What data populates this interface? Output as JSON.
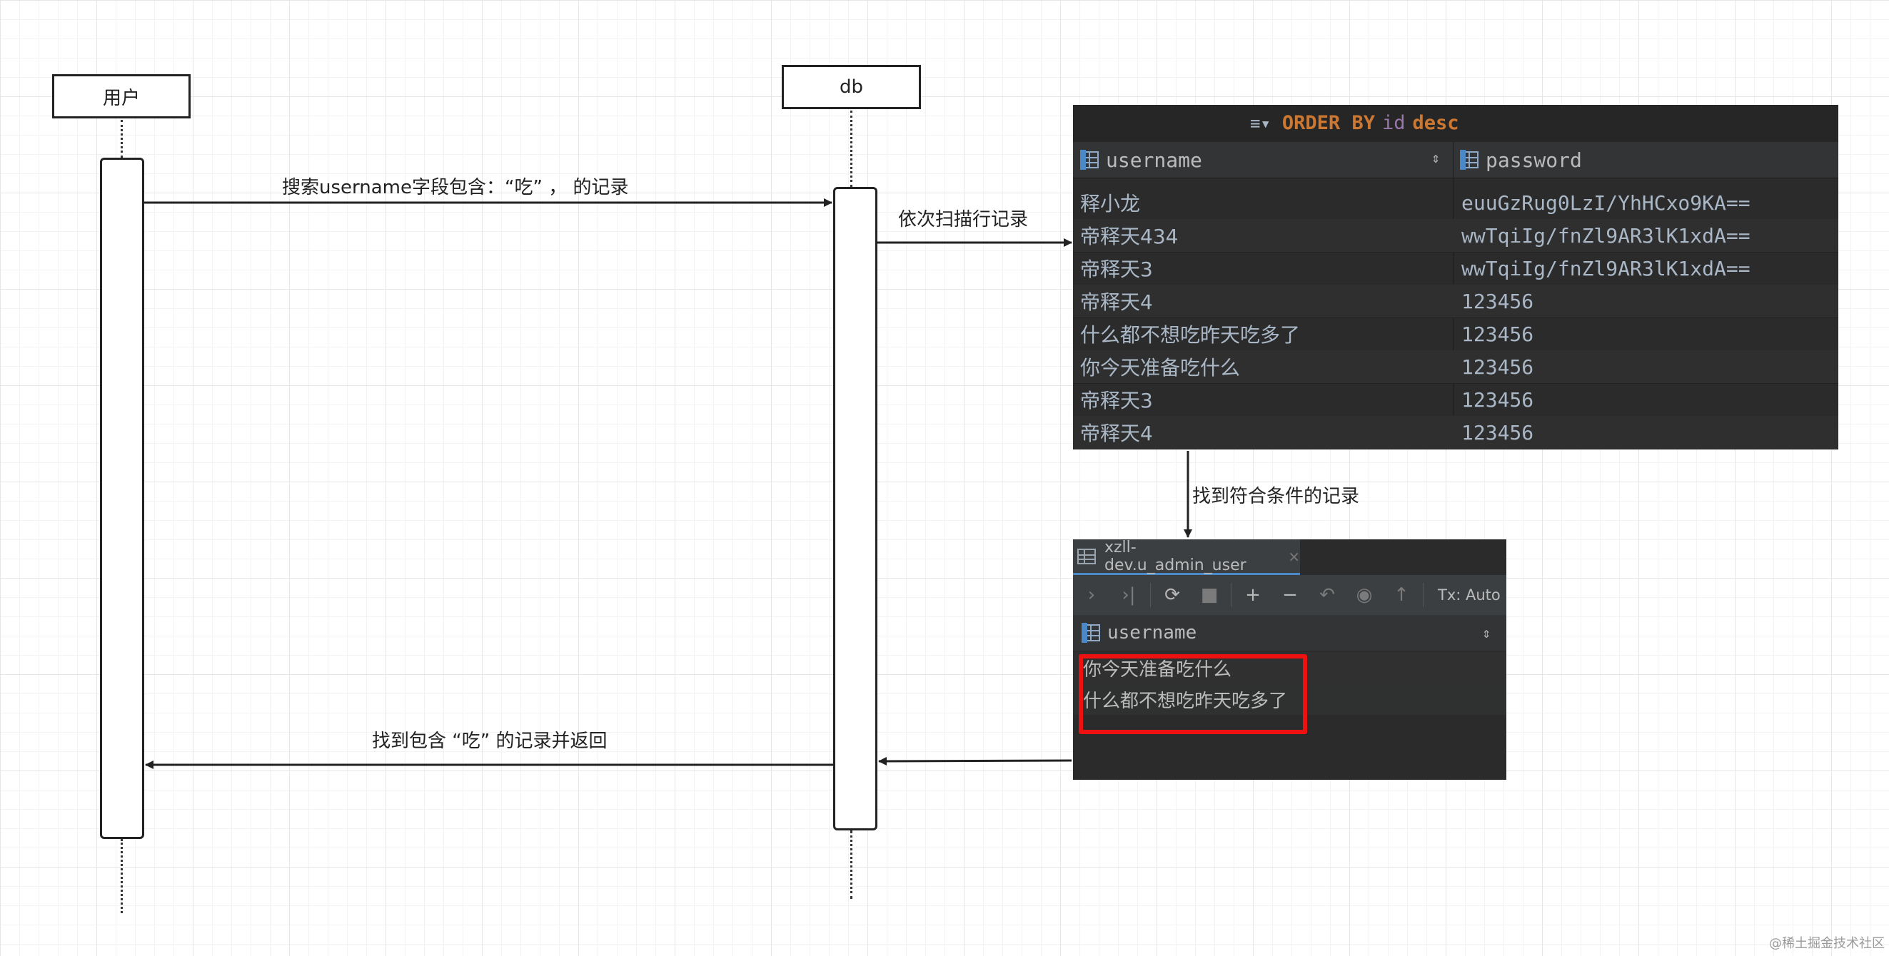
{
  "diagram": {
    "actors": {
      "user": "用户",
      "db": "db"
    },
    "messages": {
      "search": "搜索username字段包含：“吃” ，   的记录",
      "scan": "依次扫描行记录",
      "found": "找到符合条件的记录",
      "return": "找到包含 “吃” 的记录并返回"
    }
  },
  "panel1": {
    "query": {
      "order_by": "ORDER BY",
      "field": "id",
      "direction": "desc"
    },
    "columns": [
      "username",
      "password"
    ],
    "rows": [
      [
        "释小龙",
        "euuGzRug0LzI/YhHCxo9KA=="
      ],
      [
        "帝释天434",
        "wwTqiIg/fnZl9AR3lK1xdA=="
      ],
      [
        "帝释天3",
        "wwTqiIg/fnZl9AR3lK1xdA=="
      ],
      [
        "帝释天4",
        "123456"
      ],
      [
        "什么都不想吃昨天吃多了",
        "123456"
      ],
      [
        "你今天准备吃什么",
        "123456"
      ],
      [
        "帝释天3",
        "123456"
      ],
      [
        "帝释天4",
        "123456"
      ]
    ]
  },
  "panel2": {
    "tab_title": "xzll-dev.u_admin_user",
    "tx_label": "Tx: Auto",
    "column": "username",
    "rows": [
      "你今天准备吃什么",
      "什么都不想吃昨天吃多了"
    ]
  },
  "icons": {
    "tab_close": "×",
    "sorter": "⇕"
  },
  "watermark": "@稀土掘金技术社区"
}
